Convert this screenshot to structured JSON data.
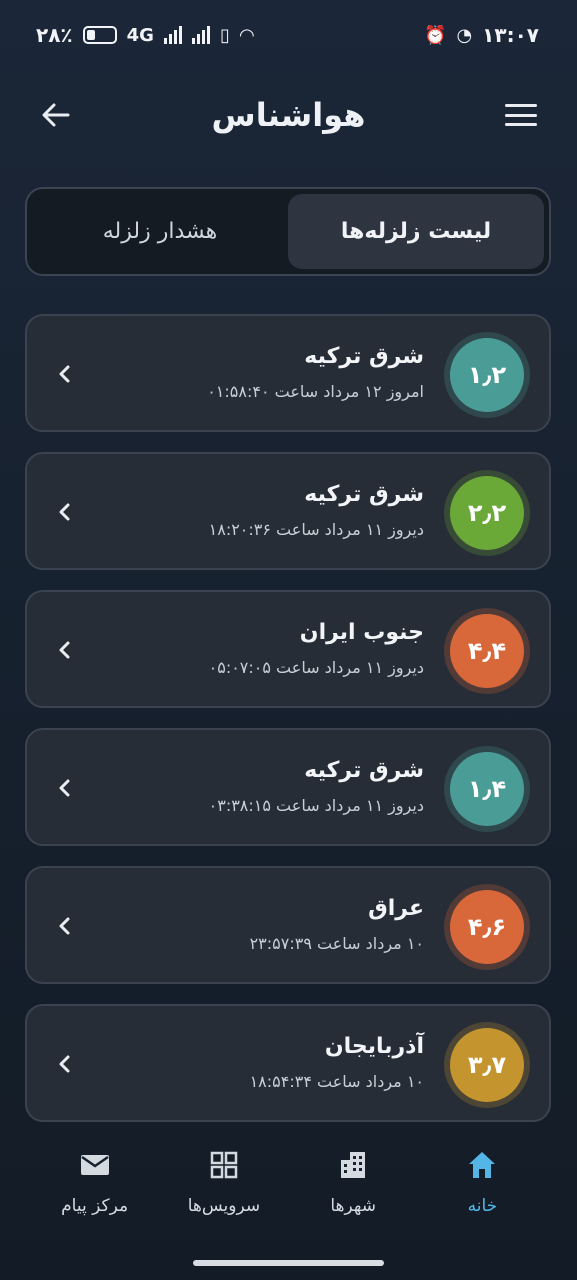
{
  "status_bar": {
    "time": "۱۳:۰۷",
    "battery": "۲۸٪",
    "network": "4G"
  },
  "header": {
    "title": "هواشناس",
    "back_icon": "arrow-left-icon",
    "menu_icon": "hamburger-menu-icon"
  },
  "tabs": [
    {
      "label": "لیست زلزله‌ها",
      "active": true
    },
    {
      "label": "هشدار زلزله",
      "active": false
    }
  ],
  "earthquakes": [
    {
      "magnitude": "۱٫۲",
      "location": "شرق ترکیه",
      "datetime": "امروز ۱۲ مرداد ساعت ۰۱:۵۸:۴۰",
      "color": "#4a9d97"
    },
    {
      "magnitude": "۲٫۲",
      "location": "شرق ترکیه",
      "datetime": "دیروز ۱۱ مرداد ساعت ۱۸:۲۰:۳۶",
      "color": "#6aa838"
    },
    {
      "magnitude": "۴٫۴",
      "location": "جنوب ایران",
      "datetime": "دیروز ۱۱ مرداد ساعت ۰۵:۰۷:۰۵",
      "color": "#d8683a"
    },
    {
      "magnitude": "۱٫۴",
      "location": "شرق ترکیه",
      "datetime": "دیروز ۱۱ مرداد ساعت ۰۳:۳۸:۱۵",
      "color": "#4a9d97"
    },
    {
      "magnitude": "۴٫۶",
      "location": "عراق",
      "datetime": "۱۰ مرداد ساعت ۲۳:۵۷:۳۹",
      "color": "#d8683a"
    },
    {
      "magnitude": "۳٫۷",
      "location": "آذربایجان",
      "datetime": "۱۰ مرداد ساعت ۱۸:۵۴:۳۴",
      "color": "#c4942e"
    }
  ],
  "bottom_nav": [
    {
      "label": "خانه",
      "icon": "home-icon",
      "active": true
    },
    {
      "label": "شهرها",
      "icon": "buildings-icon",
      "active": false
    },
    {
      "label": "سرویس‌ها",
      "icon": "grid-icon",
      "active": false
    },
    {
      "label": "مرکز پیام",
      "icon": "mail-icon",
      "active": false
    }
  ],
  "colors": {
    "accent": "#53b6e6",
    "card_bg": "#262d36"
  }
}
